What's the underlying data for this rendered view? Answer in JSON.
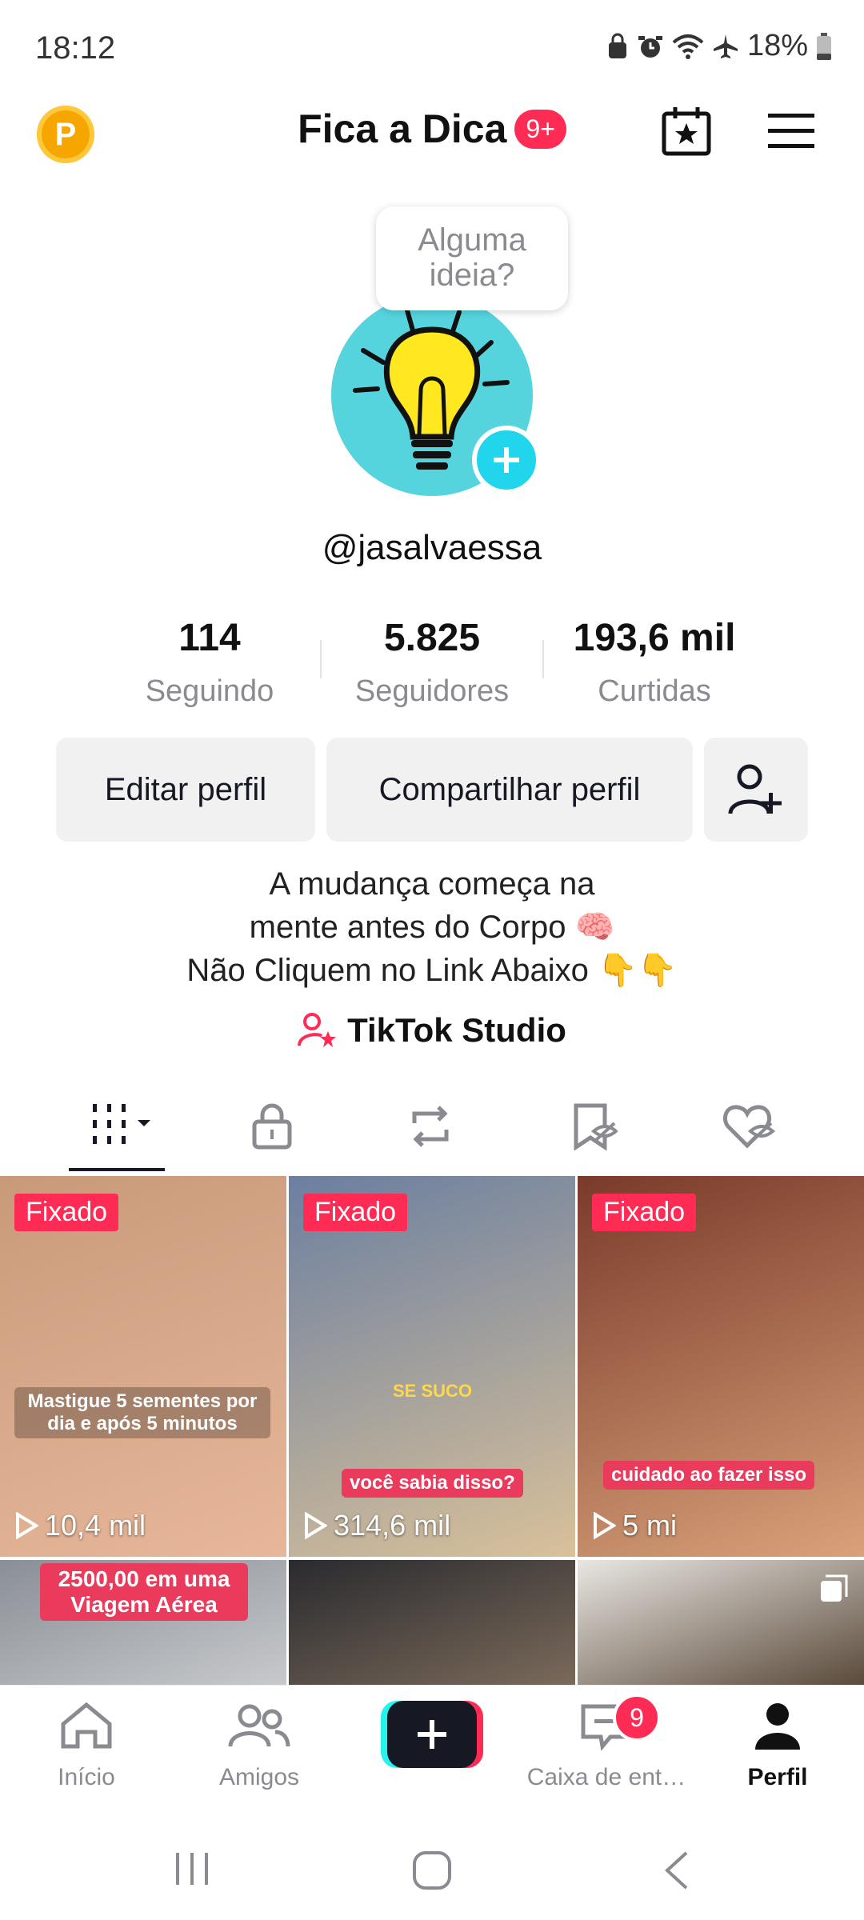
{
  "status_bar": {
    "time": "18:12",
    "battery": "18%"
  },
  "header": {
    "coin_letter": "P",
    "title": "Fica a Dica",
    "badge": "9+"
  },
  "profile": {
    "bubble_text_1": "Alguma",
    "bubble_text_2": "ideia?",
    "handle": "@jasalvaessa",
    "stats": [
      {
        "value": "114",
        "label": "Seguindo"
      },
      {
        "value": "5.825",
        "label": "Seguidores"
      },
      {
        "value": "193,6 mil",
        "label": "Curtidas"
      }
    ],
    "edit_button": "Editar perfil",
    "share_button": "Compartilhar perfil",
    "bio": [
      "A mudança começa na",
      "mente antes do Corpo 🧠",
      "Não Cliquem no Link Abaixo 👇👇"
    ],
    "studio_link": "TikTok Studio"
  },
  "videos": [
    {
      "pinned": "Fixado",
      "caption": "Mastigue 5 sementes por dia e após 5 minutos",
      "views": "10,4 mil",
      "colors": [
        "#c89a7a",
        "#e8b79a"
      ]
    },
    {
      "pinned": "Fixado",
      "caption_top": "SE SUCO",
      "caption": "você sabia disso?",
      "views": "314,6 mil",
      "colors": [
        "#6b7fa0",
        "#d9c19a"
      ]
    },
    {
      "pinned": "Fixado",
      "caption": "cuidado ao fazer isso",
      "views": "5 mi",
      "colors": [
        "#7a3a2a",
        "#d9a27a"
      ]
    },
    {
      "caption": "2500,00 em uma Viagem Aérea",
      "colors": [
        "#8a8f96",
        "#c7c9cc"
      ]
    },
    {
      "colors": [
        "#2a2a2e",
        "#7a6a5a"
      ]
    },
    {
      "colors": [
        "#e9e6e2",
        "#5a4a3a"
      ]
    }
  ],
  "nav": {
    "home": "Início",
    "friends": "Amigos",
    "inbox": "Caixa de ent…",
    "inbox_badge": "9",
    "profile": "Perfil"
  }
}
